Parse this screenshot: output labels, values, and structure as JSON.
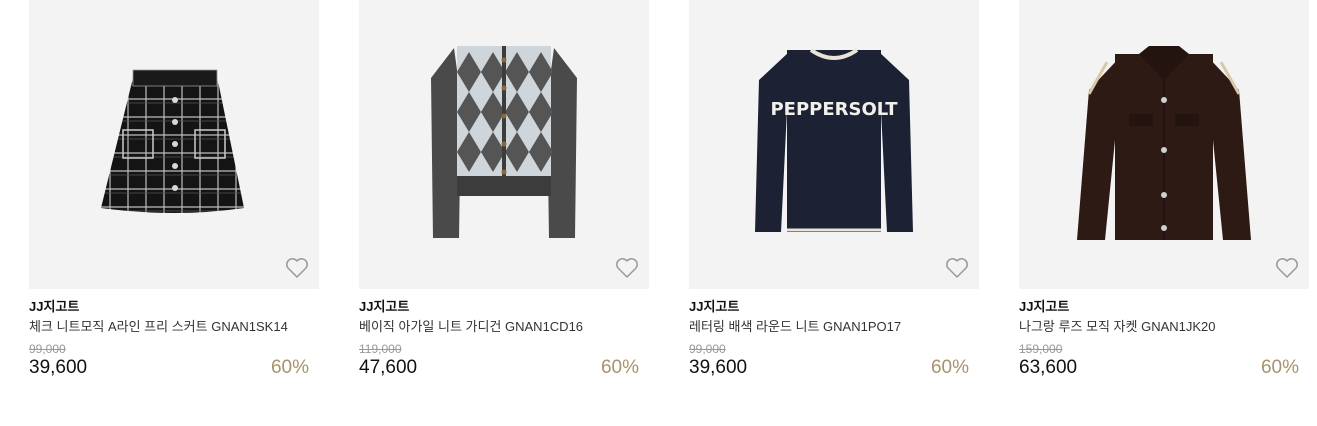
{
  "products": [
    {
      "brand": "JJ지고트",
      "name": "체크 니트모직 A라인 프리 스커트 GNAN1SK14",
      "original_price": "99,000",
      "price": "39,600",
      "discount": "60%",
      "image": "black-tweed-skirt"
    },
    {
      "brand": "JJ지고트",
      "name": "베이직 아가일 니트 가디건 GNAN1CD16",
      "original_price": "119,000",
      "price": "47,600",
      "discount": "60%",
      "image": "argyle-cardigan"
    },
    {
      "brand": "JJ지고트",
      "name": "레터링 배색 라운드 니트 GNAN1PO17",
      "original_price": "99,000",
      "price": "39,600",
      "discount": "60%",
      "image": "navy-lettering-sweater",
      "print_text": "PEPPERSOLT"
    },
    {
      "brand": "JJ지고트",
      "name": "나그랑 루즈 모직 자켓 GNAN1JK20",
      "original_price": "159,000",
      "price": "63,600",
      "discount": "60%",
      "image": "brown-wool-jacket"
    }
  ],
  "colors": {
    "discount": "#a8926c",
    "image_bg": "#f3f3f3",
    "strike": "#999999"
  },
  "icons": {
    "wishlist": "heart-outline-icon"
  }
}
